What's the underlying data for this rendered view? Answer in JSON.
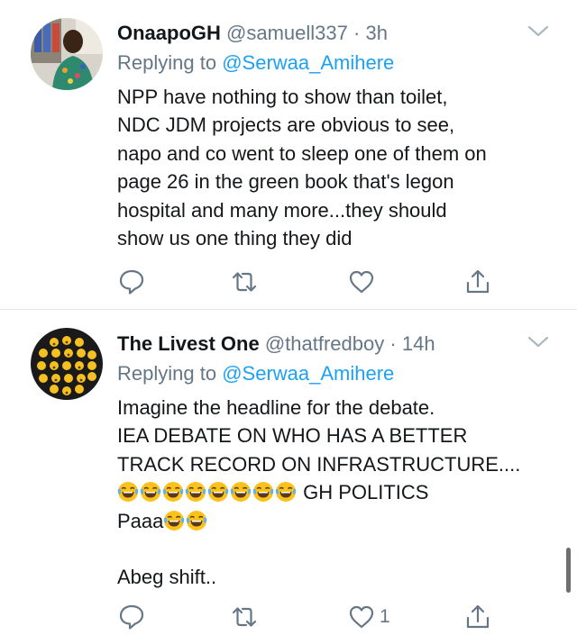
{
  "tweets": [
    {
      "name": "OnaapoGH",
      "handle": "@samuell337",
      "sep": "·",
      "time": "3h",
      "reply_prefix": "Replying to",
      "reply_to": "@Serwaa_Amihere",
      "lines": [
        "NPP have nothing to show than toilet,",
        "NDC JDM projects are obvious to see,",
        "napo and co went to sleep one of them on",
        "page 26 in the green book that's legon",
        "hospital and many more...they should",
        "show us one thing they did"
      ],
      "actions": {
        "reply_icon": "reply-icon",
        "retweet_icon": "retweet-icon",
        "like_icon": "heart-icon",
        "share_icon": "share-icon",
        "like_count": ""
      }
    },
    {
      "name": "The Livest One",
      "handle": "@thatfredboy",
      "sep": "·",
      "time": "14h",
      "reply_prefix": "Replying to",
      "reply_to": "@Serwaa_Amihere",
      "lines": [
        "Imagine the headline for the debate.",
        "IEA DEBATE ON WHO HAS A BETTER",
        "TRACK RECORD ON INFRASTRUCTURE...."
      ],
      "line4_text": " GH POLITICS",
      "line5_text": "Paaa",
      "line7_text": "Abeg shift..",
      "emoji_name": "face-with-tears-of-joy",
      "actions": {
        "reply_icon": "reply-icon",
        "retweet_icon": "retweet-icon",
        "like_icon": "heart-icon",
        "share_icon": "share-icon",
        "like_count": "1"
      }
    }
  ],
  "colors": {
    "text": "#14171a",
    "secondary": "#657786",
    "link": "#1da1f2",
    "divider": "#e1e8ed"
  }
}
